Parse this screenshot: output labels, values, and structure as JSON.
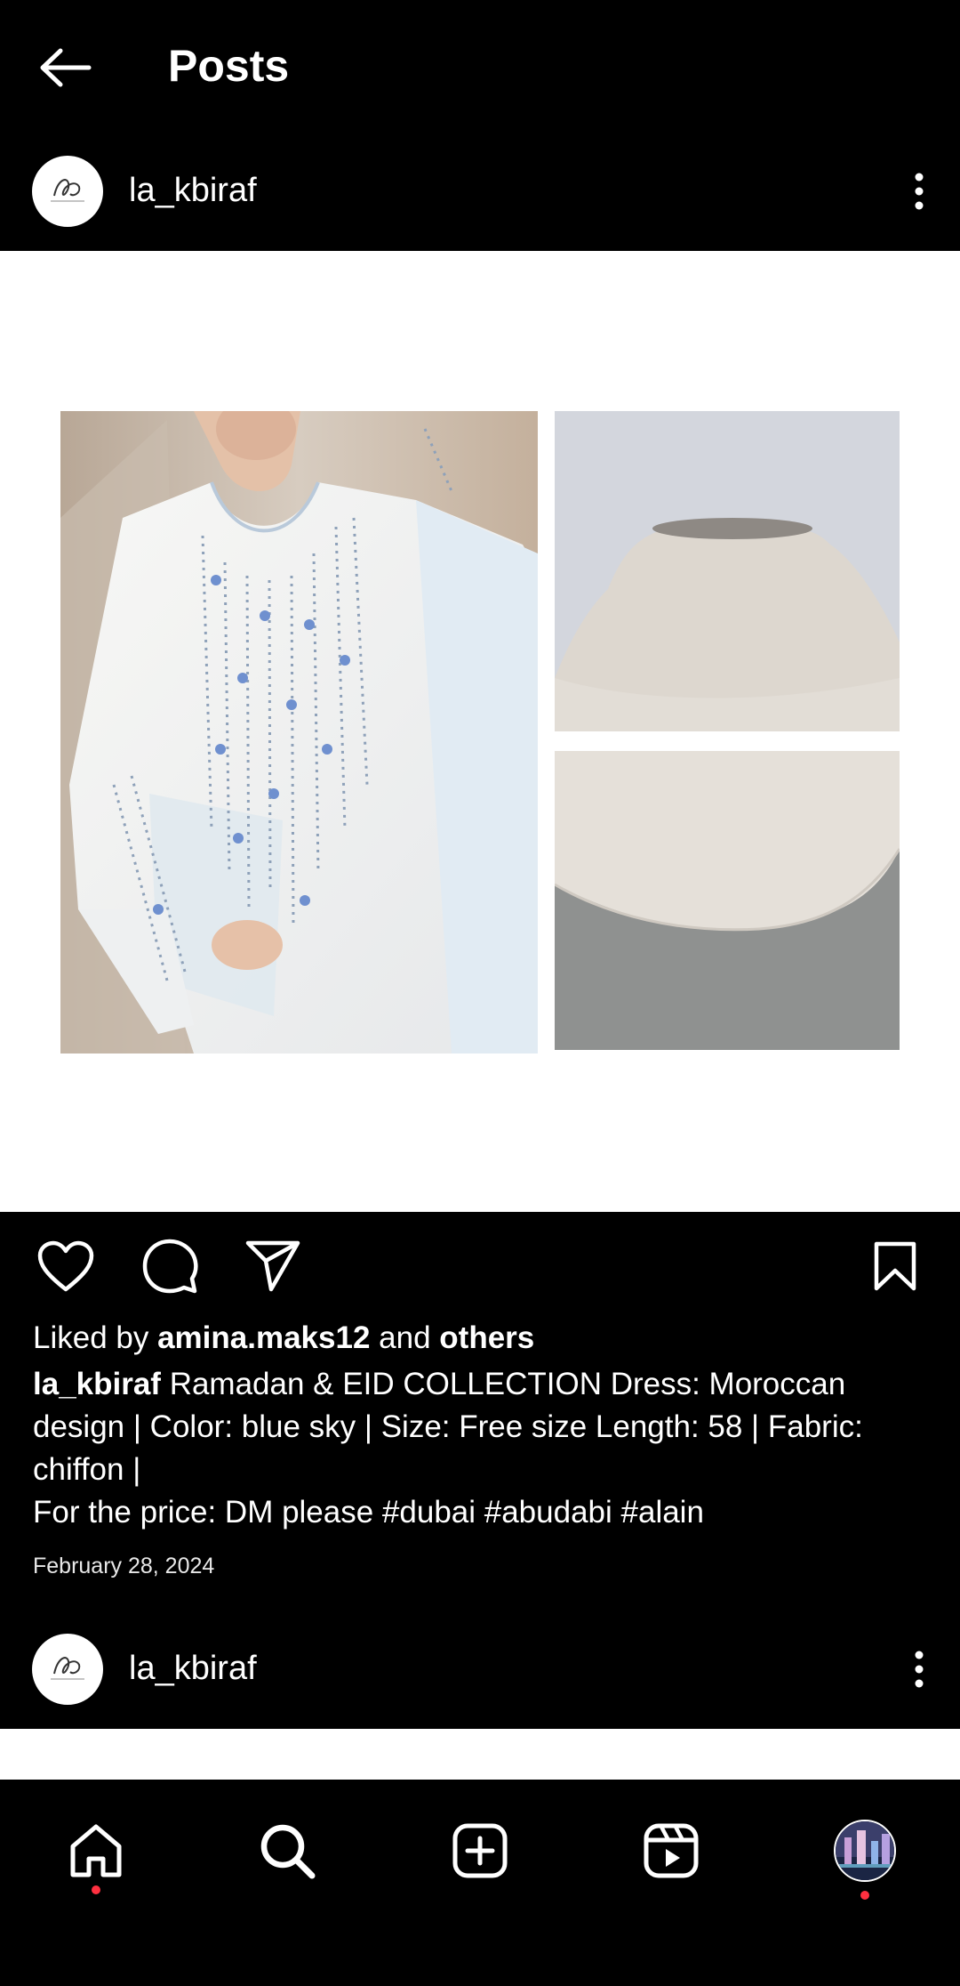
{
  "header": {
    "title": "Posts"
  },
  "post": {
    "username": "la_kbiraf",
    "liked_by_prefix": "Liked by ",
    "liked_by_user": "amina.maks12",
    "liked_by_and": " and ",
    "liked_by_others": "others",
    "caption_user": "la_kbiraf",
    "caption_text": " Ramadan & EID COLLECTION  Dress: Moroccan design | Color: blue sky | Size: Free size  Length: 58 | Fabric: chiffon |",
    "caption_line2": "For the price: DM please  #dubai #abudabi #alain",
    "date": "February 28, 2024"
  },
  "next_post": {
    "username": "la_kbiraf"
  },
  "icons": {
    "back": "arrow-left-icon",
    "more": "vertical-ellipsis-icon",
    "like": "heart-icon",
    "comment": "speech-bubble-icon",
    "share": "paper-plane-icon",
    "save": "bookmark-icon",
    "home": "home-icon",
    "search": "search-icon",
    "create": "plus-square-icon",
    "reels": "reels-icon",
    "profile": "profile-avatar"
  },
  "colors": {
    "background": "#000000",
    "text": "#ffffff",
    "notification_dot": "#ff3040"
  }
}
